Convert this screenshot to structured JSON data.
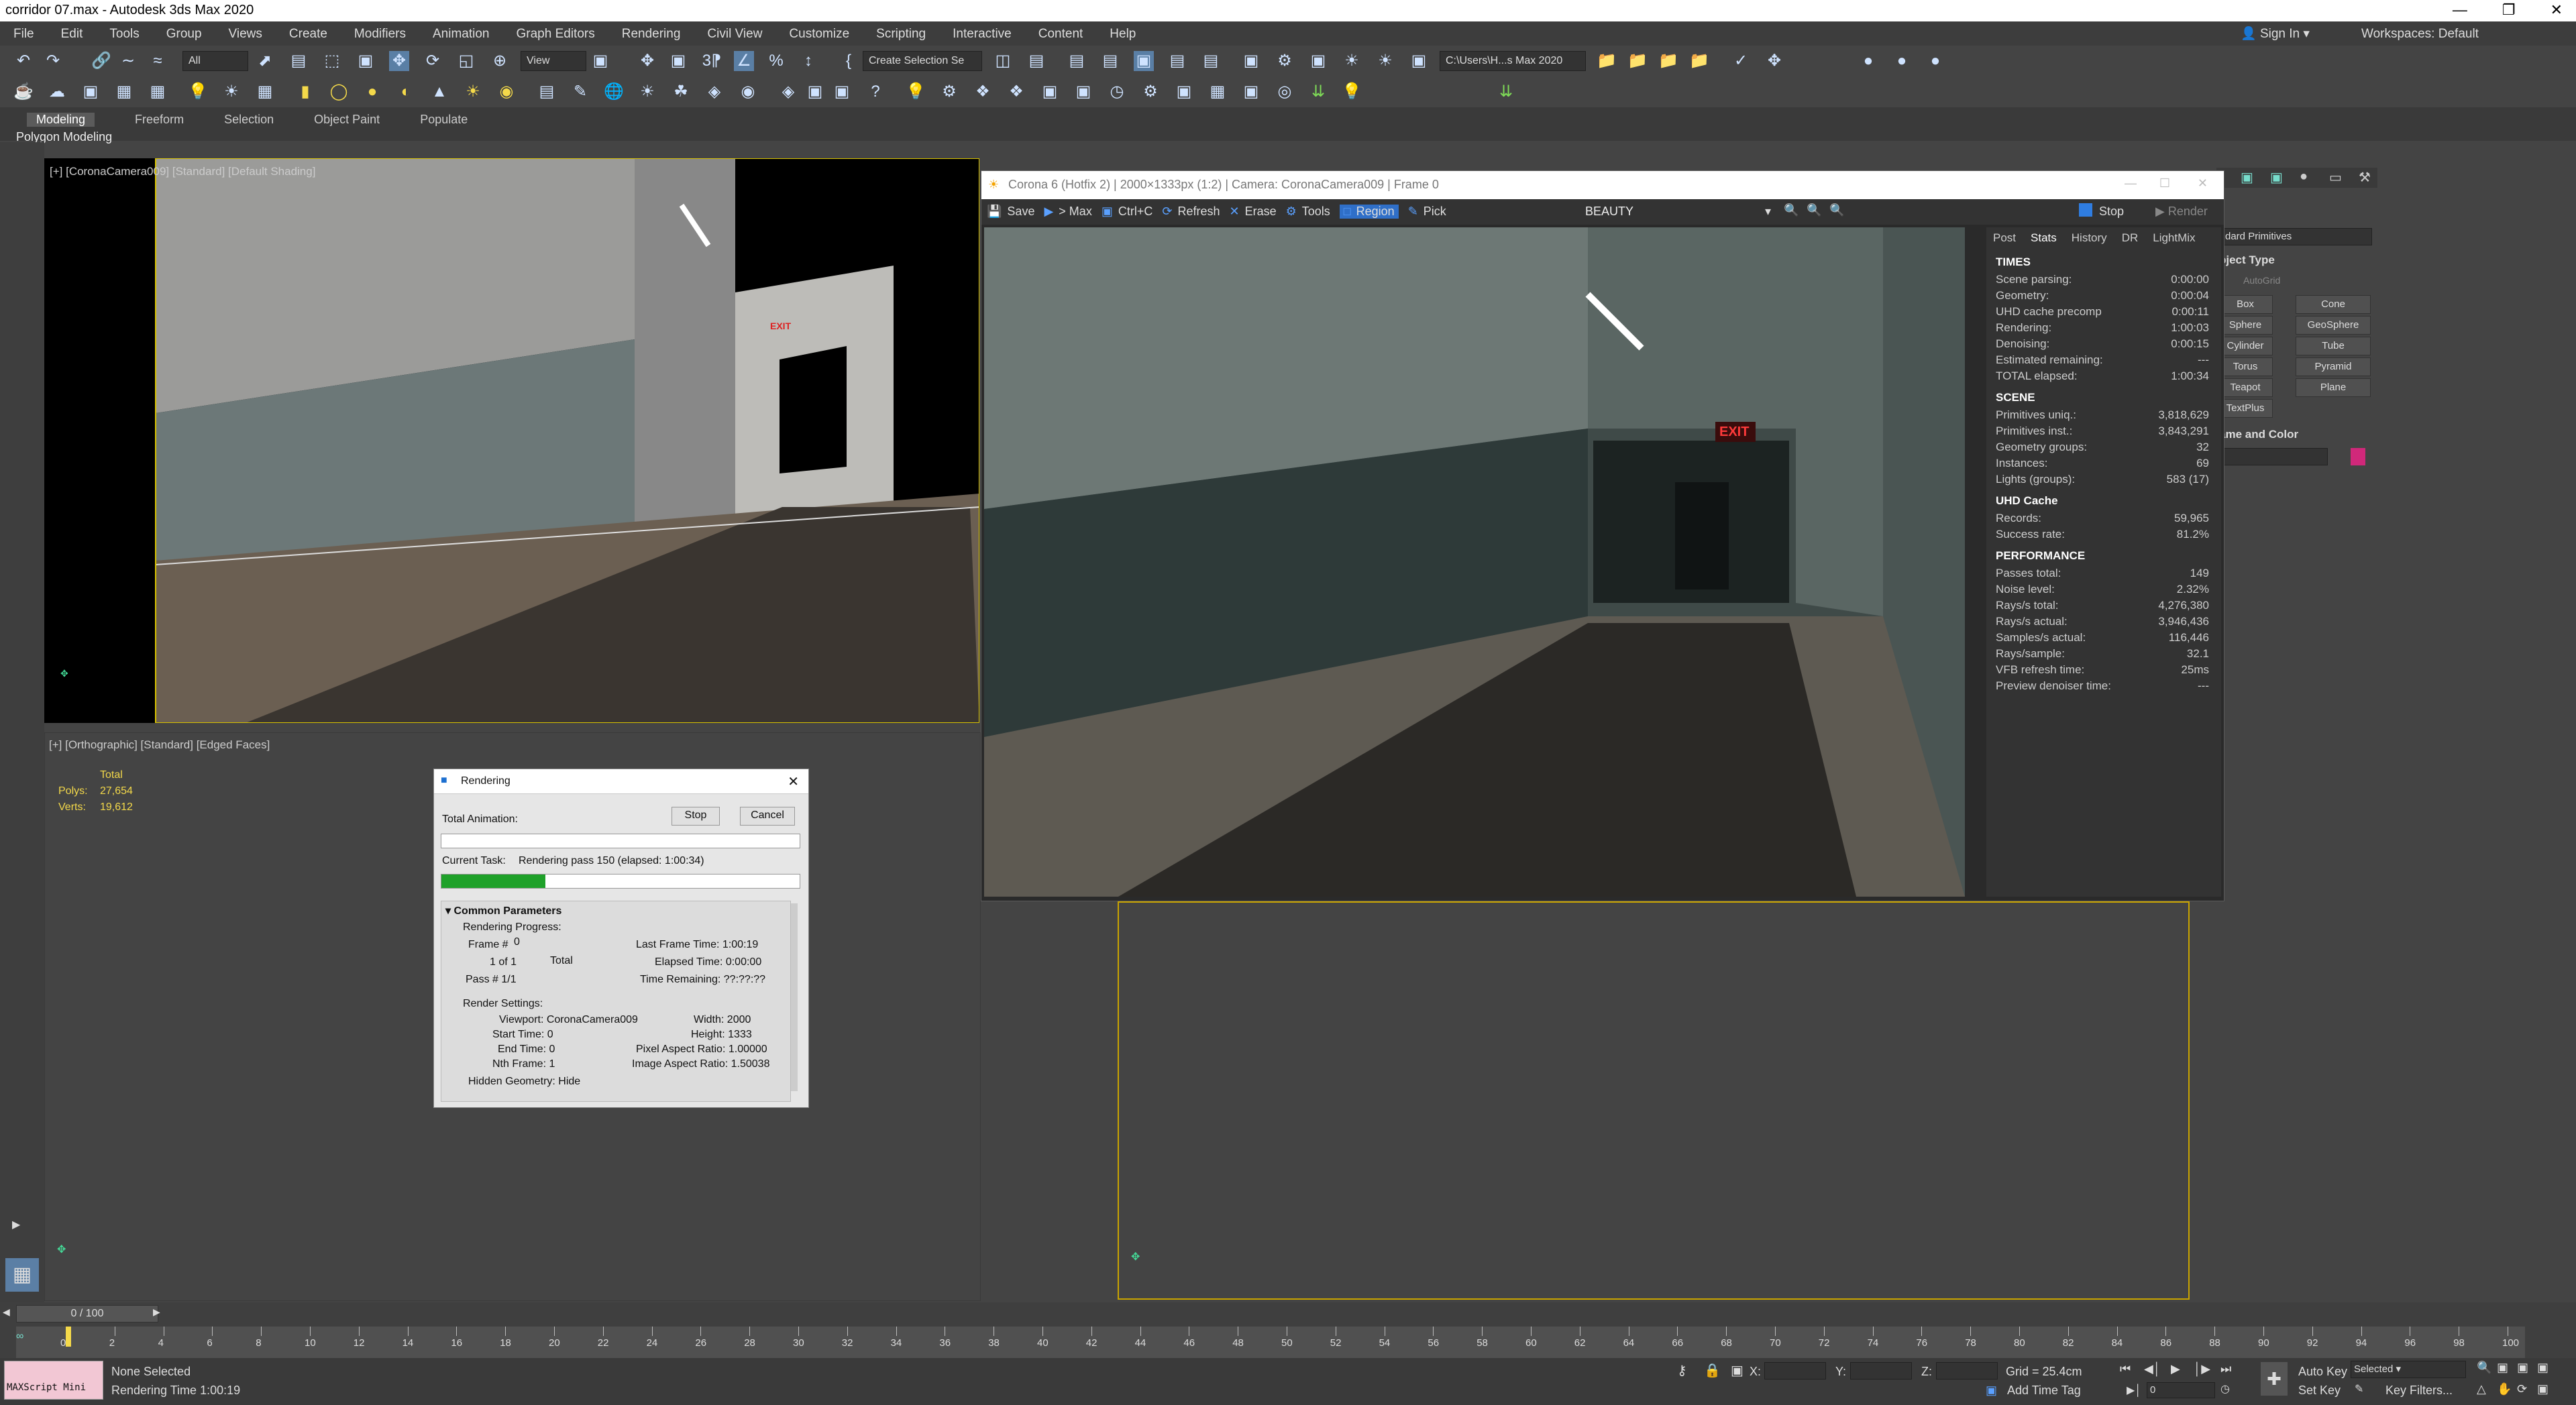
{
  "window": {
    "title": "corridor 07.max - Autodesk 3ds Max 2020"
  },
  "menu": {
    "items": [
      "File",
      "Edit",
      "Tools",
      "Group",
      "Views",
      "Create",
      "Modifiers",
      "Animation",
      "Graph Editors",
      "Rendering",
      "Civil View",
      "Customize",
      "Scripting",
      "Interactive",
      "Content",
      "Help"
    ],
    "sign_in": "Sign In",
    "workspaces_label": "Workspaces:",
    "workspaces_value": "Default"
  },
  "toolbar": {
    "filter": "All",
    "view": "View",
    "selection_set": "Create Selection Se",
    "path": "C:\\Users\\H...s Max 2020"
  },
  "ribbon": {
    "tabs": [
      "Modeling",
      "Freeform",
      "Selection",
      "Object Paint",
      "Populate"
    ],
    "sub": "Polygon Modeling"
  },
  "viewport_top": {
    "label": "[+] [CoronaCamera009] [Standard] [Default Shading]",
    "exit_sign": "EXIT"
  },
  "viewport_bottom": {
    "label": "[+] [Orthographic] [Standard] [Edged Faces]",
    "stats_total": "Total",
    "polys_label": "Polys:",
    "polys_value": "27,654",
    "verts_label": "Verts:",
    "verts_value": "19,612"
  },
  "vfb": {
    "title": "Corona 6 (Hotfix 2) | 2000×1333px (1:2) | Camera: CoronaCamera009 | Frame 0",
    "toolbar": [
      "Save",
      "> Max",
      "Ctrl+C",
      "Refresh",
      "Erase",
      "Tools",
      "Region",
      "Pick"
    ],
    "channel": "BEAUTY",
    "stop": "Stop",
    "render": "Render",
    "exit_sign": "EXIT",
    "stats_tabs": [
      "Post",
      "Stats",
      "History",
      "DR",
      "LightMix"
    ],
    "sections": [
      {
        "title": "TIMES",
        "rows": [
          [
            "Scene parsing:",
            "0:00:00"
          ],
          [
            "Geometry:",
            "0:00:04"
          ],
          [
            "UHD cache precomp",
            "0:00:11"
          ],
          [
            "Rendering:",
            "1:00:03"
          ],
          [
            "Denoising:",
            "0:00:15"
          ],
          [
            "Estimated remaining:",
            "---"
          ],
          [
            "TOTAL elapsed:",
            "1:00:34"
          ]
        ]
      },
      {
        "title": "SCENE",
        "rows": [
          [
            "Primitives uniq.:",
            "3,818,629"
          ],
          [
            "Primitives inst.:",
            "3,843,291"
          ],
          [
            "Geometry groups:",
            "32"
          ],
          [
            "Instances:",
            "69"
          ],
          [
            "Lights (groups):",
            "583 (17)"
          ]
        ]
      },
      {
        "title": "UHD Cache",
        "rows": [
          [
            "Records:",
            "59,965"
          ],
          [
            "Success rate:",
            "81.2%"
          ]
        ]
      },
      {
        "title": "PERFORMANCE",
        "rows": [
          [
            "Passes total:",
            "149"
          ],
          [
            "Noise level:",
            "2.32%"
          ],
          [
            "Rays/s total:",
            "4,276,380"
          ],
          [
            "Rays/s actual:",
            "3,946,436"
          ],
          [
            "Samples/s actual:",
            "116,446"
          ],
          [
            "Rays/sample:",
            "32.1"
          ],
          [
            "VFB refresh time:",
            "25ms"
          ],
          [
            "Preview denoiser time:",
            "---"
          ]
        ]
      }
    ]
  },
  "command_panel": {
    "category": "dard Primitives",
    "object_type": "bject Type",
    "autogrid": "AutoGrid",
    "buttons": [
      "Box",
      "Cone",
      "Sphere",
      "GeoSphere",
      "Cylinder",
      "Tube",
      "Torus",
      "Pyramid",
      "Teapot",
      "Plane",
      "TextPlus"
    ],
    "name_color": "ame and Color",
    "swatch_color": "#d0287a"
  },
  "render_dialog": {
    "title": "Rendering",
    "total_animation": "Total Animation:",
    "stop": "Stop",
    "cancel": "Cancel",
    "current_task_label": "Current Task:",
    "current_task": "Rendering pass 150 (elapsed: 1:00:34)",
    "progress": 0.29,
    "common_params": "Common Parameters",
    "rendering_progress": "Rendering Progress:",
    "frame_label": "Frame #",
    "frame_value": "0",
    "last_frame_time": "Last Frame Time:  1:00:19",
    "of": "1 of 1",
    "total": "Total",
    "elapsed": "Elapsed Time:  0:00:00",
    "pass": "Pass #  1/1",
    "remaining": "Time Remaining:  ??:??:??",
    "render_settings": "Render Settings:",
    "viewport": "Viewport:  CoronaCamera009",
    "width": "Width:  2000",
    "start_time": "Start Time:  0",
    "height": "Height:  1333",
    "end_time": "End Time:  0",
    "pixel_aspect": "Pixel Aspect Ratio:  1.00000",
    "nth_frame": "Nth Frame:  1",
    "image_aspect": "Image Aspect Ratio:  1.50038",
    "cut_line": "Hidden Geometry: Hide"
  },
  "timeline": {
    "counter": "0 / 100",
    "ticks": [
      "0",
      "2",
      "4",
      "6",
      "8",
      "10",
      "12",
      "14",
      "16",
      "18",
      "20",
      "22",
      "24",
      "26",
      "28",
      "30",
      "32",
      "34",
      "36",
      "38",
      "40",
      "42",
      "44",
      "46",
      "48",
      "50",
      "52",
      "54",
      "56",
      "58",
      "60",
      "62",
      "64",
      "66",
      "68",
      "70",
      "72",
      "74",
      "76",
      "78",
      "80",
      "82",
      "84",
      "86",
      "88",
      "90",
      "92",
      "94",
      "96",
      "98",
      "100"
    ]
  },
  "status": {
    "maxscript": "MAXScript Mini",
    "selection": "None Selected",
    "render_time": "Rendering Time  1:00:19",
    "x": "X:",
    "y": "Y:",
    "z": "Z:",
    "grid": "Grid = 25.4cm",
    "add_time_tag": "Add Time Tag",
    "auto_key": "Auto Key",
    "selected": "Selected",
    "set_key": "Set Key",
    "key_filters": "Key Filters...",
    "frame": "0"
  }
}
